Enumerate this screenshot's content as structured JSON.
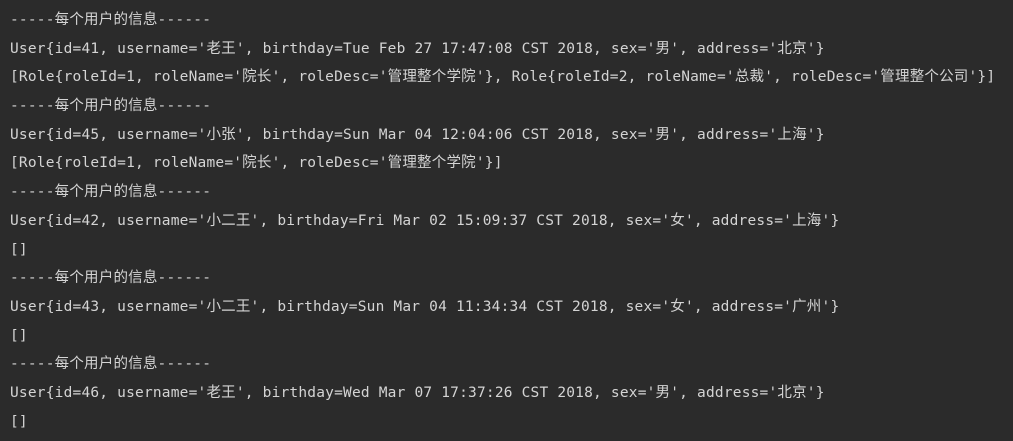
{
  "console": {
    "lines": [
      "-----每个用户的信息------",
      "User{id=41, username='老王', birthday=Tue Feb 27 17:47:08 CST 2018, sex='男', address='北京'}",
      "[Role{roleId=1, roleName='院长', roleDesc='管理整个学院'}, Role{roleId=2, roleName='总裁', roleDesc='管理整个公司'}]",
      "-----每个用户的信息------",
      "User{id=45, username='小张', birthday=Sun Mar 04 12:04:06 CST 2018, sex='男', address='上海'}",
      "[Role{roleId=1, roleName='院长', roleDesc='管理整个学院'}]",
      "-----每个用户的信息------",
      "User{id=42, username='小二王', birthday=Fri Mar 02 15:09:37 CST 2018, sex='女', address='上海'}",
      "[]",
      "-----每个用户的信息------",
      "User{id=43, username='小二王', birthday=Sun Mar 04 11:34:34 CST 2018, sex='女', address='广州'}",
      "[]",
      "-----每个用户的信息------",
      "User{id=46, username='老王', birthday=Wed Mar 07 17:37:26 CST 2018, sex='男', address='北京'}",
      "[]"
    ]
  },
  "colors": {
    "background": "#2b2b2b",
    "text": "#d4d4d4"
  }
}
